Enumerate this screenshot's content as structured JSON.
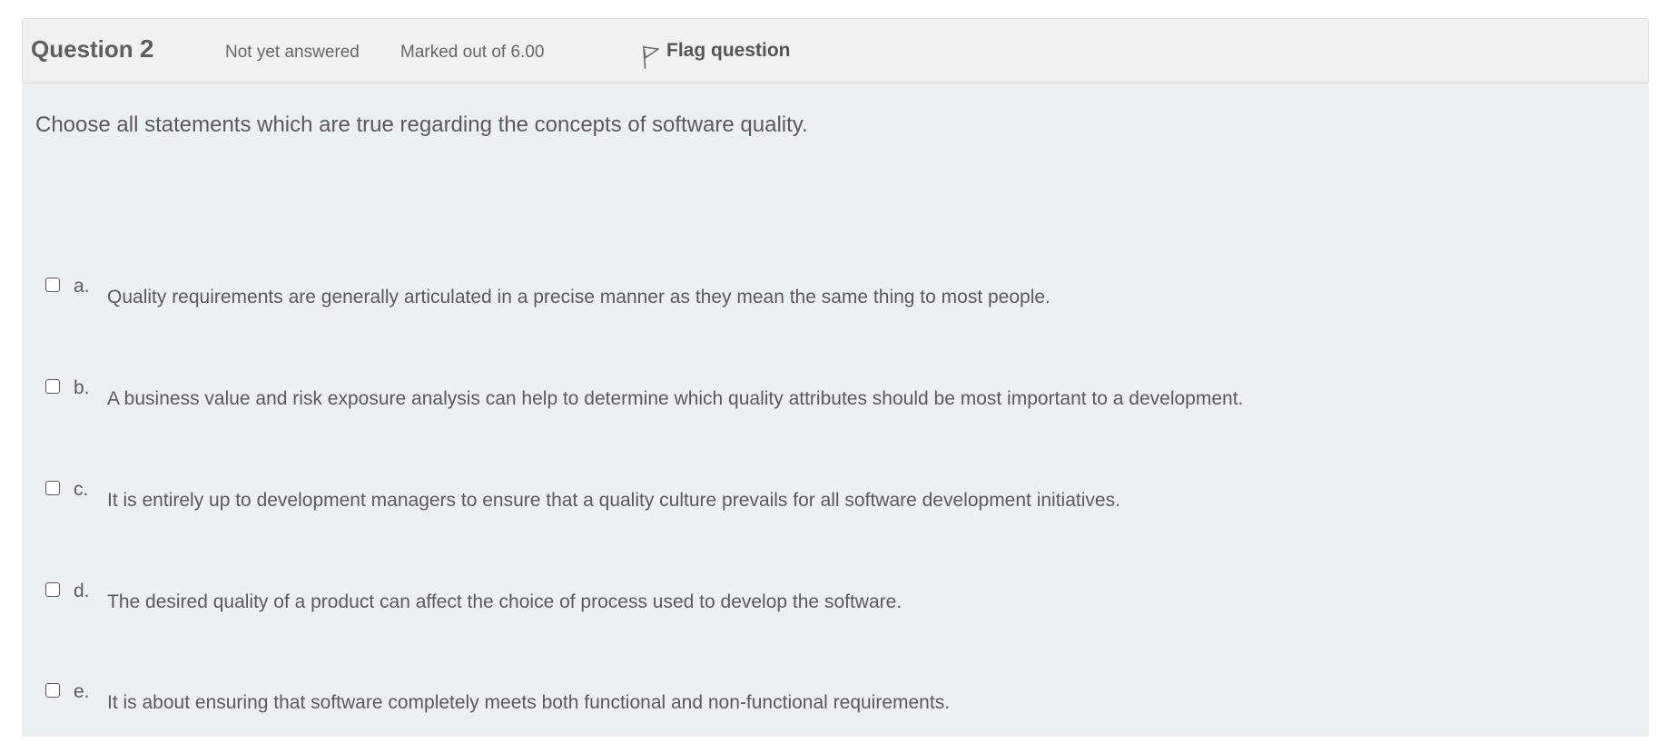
{
  "question": {
    "title_prefix": "Question ",
    "number": "2",
    "state": "Not yet answered",
    "grade": "Marked out of 6.00",
    "flag_label": "Flag question",
    "flag_icon": "flag-icon",
    "text": "Choose all statements which are true regarding the concepts of software quality."
  },
  "answers": [
    {
      "letter": "a.",
      "text": "Quality requirements are generally articulated in a precise manner as they mean the same thing to most people.",
      "checked": false
    },
    {
      "letter": "b.",
      "text": "A  business value and risk exposure analysis can help to determine which quality attributes should be most important to a development.",
      "checked": false
    },
    {
      "letter": "c.",
      "text": "It is entirely up to development managers to ensure that a quality culture prevails for all software development initiatives.",
      "checked": false
    },
    {
      "letter": "d.",
      "text": "The desired quality of a product can affect the choice of process used to develop the software.",
      "checked": false
    },
    {
      "letter": "e.",
      "text": "It is about ensuring that software completely meets both functional and non-functional requirements.",
      "checked": false
    }
  ],
  "colors": {
    "info_bar_bg": "#f1f1f1",
    "content_bg": "#ebf0f2",
    "text": "#5a5a5a"
  }
}
